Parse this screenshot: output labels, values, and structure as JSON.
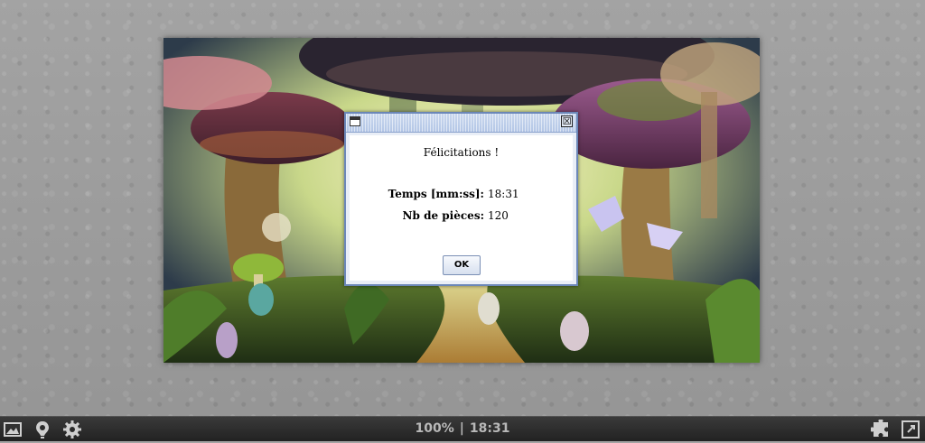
{
  "dialog": {
    "message": "Félicitations !",
    "stats": [
      {
        "label": "Temps [mm:ss]:",
        "value": "18:31"
      },
      {
        "label": "Nb de pièces:",
        "value": "120"
      }
    ],
    "ok_label": "OK",
    "close_glyph": "☒"
  },
  "toolbar": {
    "zoom": "100%",
    "separator": "|",
    "elapsed": "18:31",
    "icons": [
      "image-icon",
      "hint-icon",
      "gear-icon",
      "puzzle-piece-icon",
      "fullscreen-icon"
    ]
  }
}
